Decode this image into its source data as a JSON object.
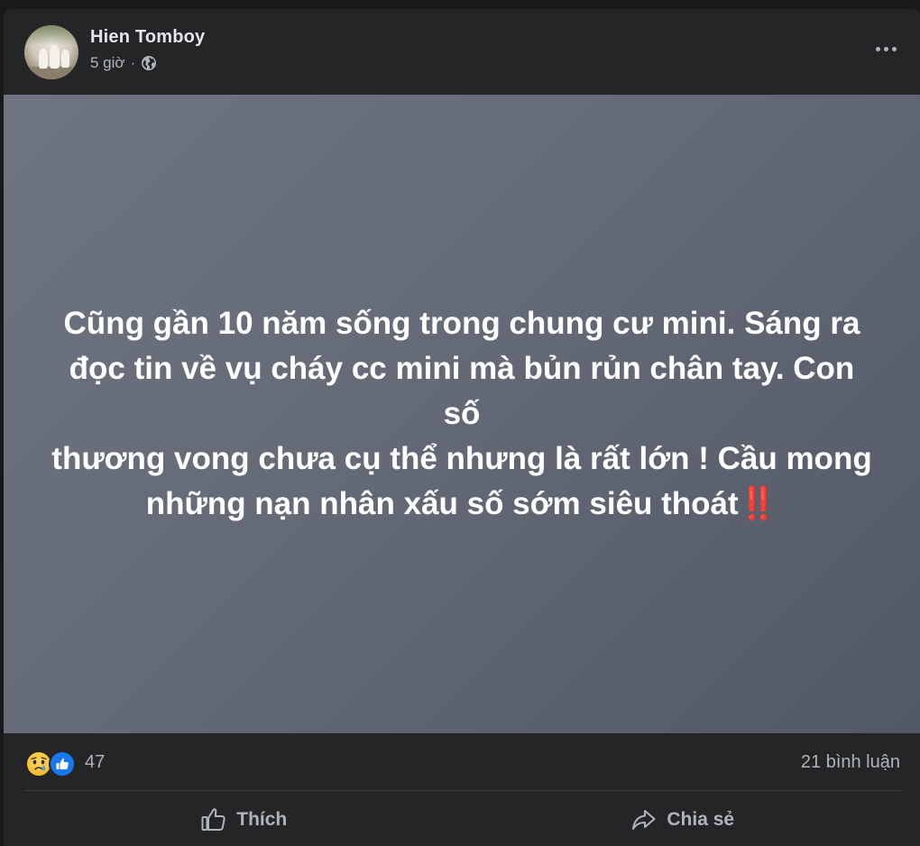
{
  "post": {
    "author_name": "Hien Tomboy",
    "timestamp": "5 giờ",
    "separator": "·",
    "privacy_icon": "globe-icon",
    "more_icon": "more-options-icon",
    "status_lines": [
      "Cũng gần 10 năm sống trong chung cư mini. Sáng ra",
      "đọc tin về vụ cháy cc mini mà bủn rủn chân tay. Con số",
      "thương vong chưa cụ thể nhưng là rất lớn ! Cầu mong",
      "những nạn nhân xấu số sớm siêu thoát"
    ],
    "status_emoji": "‼️",
    "background_colors": [
      "#6f7580",
      "#525865"
    ]
  },
  "reactions": {
    "icons": [
      "sad-reaction-icon",
      "like-reaction-icon"
    ],
    "count": "47",
    "comments": "21 bình luận"
  },
  "actions": {
    "like_label": "Thích",
    "share_label": "Chia sẻ"
  },
  "colors": {
    "card_bg": "#242526",
    "text_primary": "#e4e6eb",
    "text_secondary": "#b0b3b8",
    "like_blue": "#1877f2"
  }
}
